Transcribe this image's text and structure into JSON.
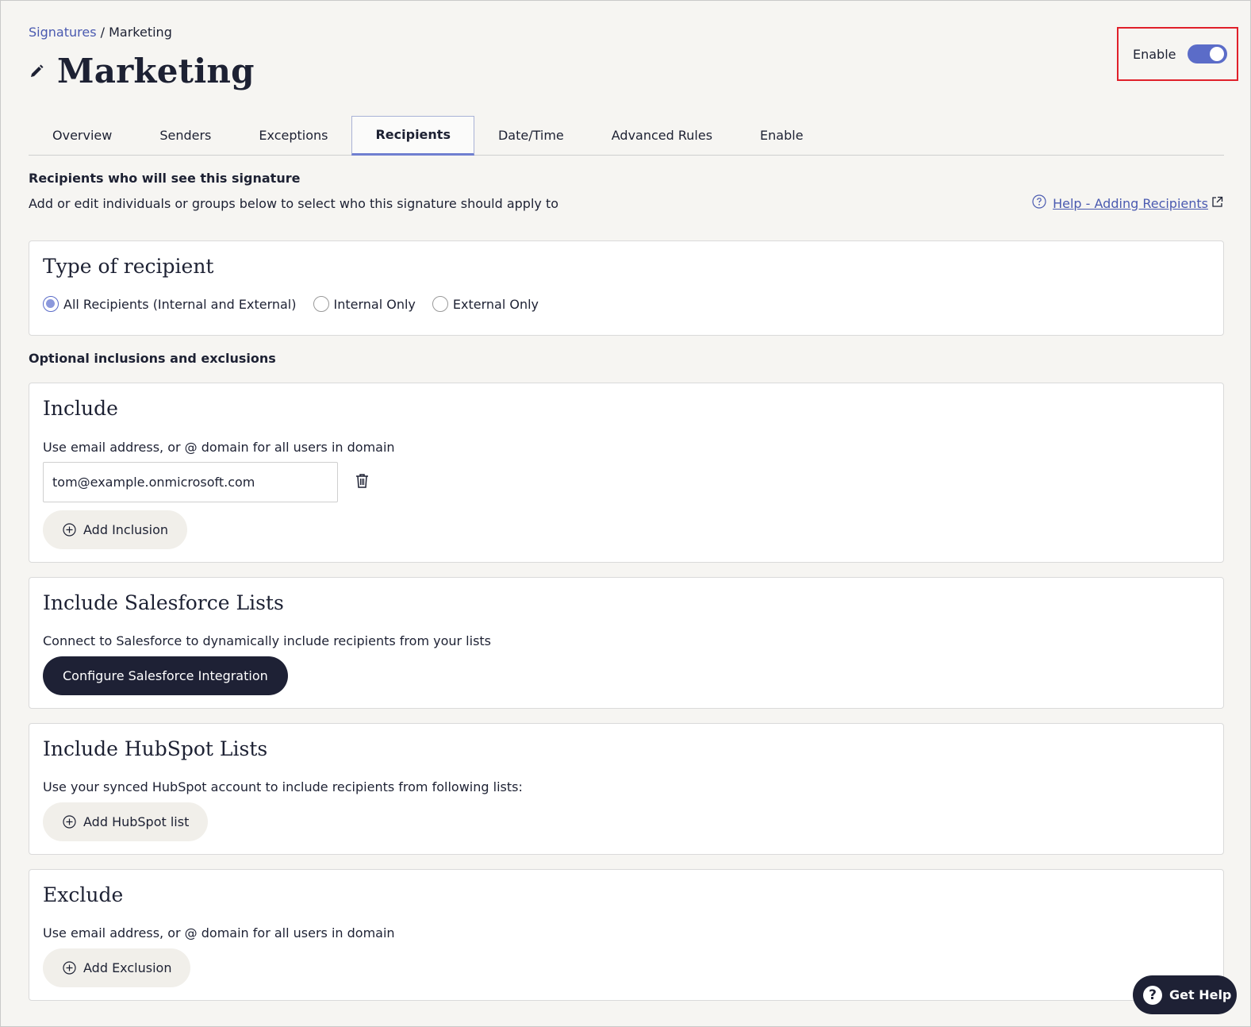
{
  "breadcrumb": {
    "parent": "Signatures",
    "separator": "/",
    "current": "Marketing"
  },
  "page": {
    "title": "Marketing",
    "edit_icon": "pencil-icon"
  },
  "enable_toggle": {
    "label": "Enable",
    "state": true,
    "accent": "#5b6cc8"
  },
  "tabs": [
    {
      "label": "Overview"
    },
    {
      "label": "Senders"
    },
    {
      "label": "Exceptions"
    },
    {
      "label": "Recipients",
      "active": true
    },
    {
      "label": "Date/Time"
    },
    {
      "label": "Advanced Rules"
    },
    {
      "label": "Enable"
    }
  ],
  "recipients": {
    "heading": "Recipients who will see this signature",
    "subtext": "Add or edit individuals or groups below to select who this signature should apply to",
    "help_link": "Help - Adding Recipients"
  },
  "type_card": {
    "title": "Type of recipient",
    "options": [
      {
        "label": "All Recipients (Internal and External)",
        "checked": true
      },
      {
        "label": "Internal Only",
        "checked": false
      },
      {
        "label": "External Only",
        "checked": false
      }
    ]
  },
  "optional_heading": "Optional inclusions and exclusions",
  "include_card": {
    "title": "Include",
    "desc": "Use email address, or @ domain for all users in domain",
    "email_value": "tom@example.onmicrosoft.com",
    "add_button": "Add Inclusion"
  },
  "salesforce_card": {
    "title": "Include Salesforce Lists",
    "desc": "Connect to Salesforce to dynamically include recipients from your lists",
    "button": "Configure Salesforce Integration"
  },
  "hubspot_card": {
    "title": "Include HubSpot Lists",
    "desc": "Use your synced HubSpot account to include recipients from following lists:",
    "add_button": "Add HubSpot list"
  },
  "exclude_card": {
    "title": "Exclude",
    "desc": "Use email address, or @ domain for all users in domain",
    "add_button": "Add Exclusion"
  },
  "get_help": {
    "label": "Get Help"
  },
  "colors": {
    "accent": "#5b6cc8",
    "dark": "#1e2135",
    "link": "#4a5ab0",
    "highlight": "#e0202a"
  }
}
